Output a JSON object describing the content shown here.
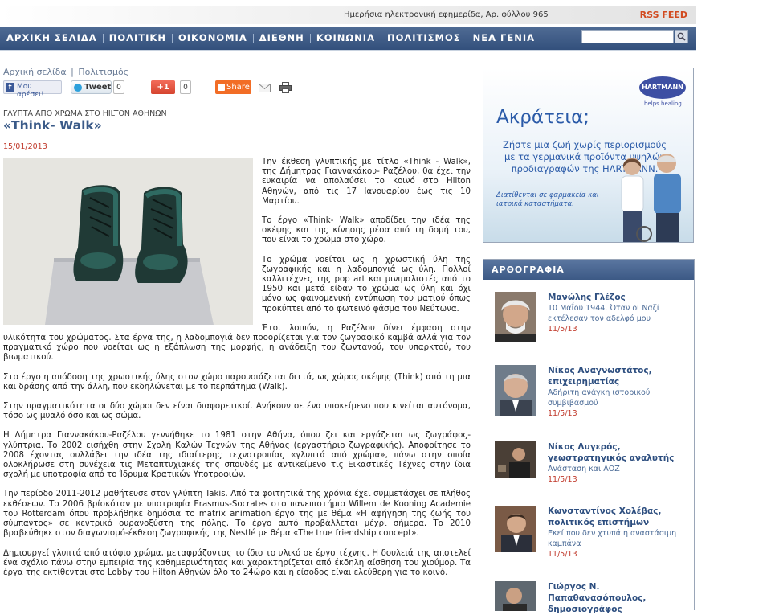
{
  "topbar": {
    "info": "Ημερήσια ηλεκτρονική εφημερίδα, Αρ. φύλλου 965",
    "rss": "RSS FEED"
  },
  "nav": {
    "items": [
      "ΑΡΧΙΚΗ ΣΕΛΙΔΑ",
      "ΠΟΛΙΤΙΚΗ",
      "ΟΙΚΟΝΟΜΙΑ",
      "ΔΙΕΘΝΗ",
      "ΚΟΙΝΩΝΙΑ",
      "ΠΟΛΙΤΙΣΜΟΣ",
      "ΝΕΑ ΓΕΝΙΑ"
    ],
    "search_placeholder": ""
  },
  "breadcrumb": {
    "home": "Αρχική σελίδα",
    "separator": "|",
    "section": "Πολιτισμός"
  },
  "social": {
    "facebook_label": "Μου αρέσει!",
    "facebook_icon": "f",
    "tweet_label": "Tweet",
    "tweet_count": "0",
    "gplus_label": "+1",
    "gplus_count": "0",
    "share_label": "Share"
  },
  "article": {
    "kicker": "ΓΛΥΠΤΑ ΑΠΟ ΧΡΩΜΑ ΣΤΟ HILTON ΑΘΗΝΩΝ",
    "title": "«Think- Walk»",
    "date": "15/01/2013",
    "paragraphs": [
      "Την έκθεση γλυπτικής με τίτλο «Think - Walk», της Δήμητρας Γιαννακάκου- Ραζέλου, θα έχει την ευκαιρία να απολαύσει το κοινό στο Hilton Αθηνών, από τις 17 Ιανουαρίου έως τις 10 Μαρτίου.",
      "Το έργο «Think- Walk» αποδίδει την ιδέα της σκέψης και της κίνησης μέσα από τη δομή του, που είναι το χρώμα στο χώρο.",
      "Το χρώμα νοείται ως η χρωστική ύλη της ζωγραφικής και η λαδομπογιά ως ύλη. Πολλοί καλλιτέχνες της pop art και μινιμαλιστές από το 1950 και μετά είδαν το χρώμα ως ύλη και όχι μόνο ως φαινομενική εντύπωση του ματιού όπως προκύπτει από το φωτεινό φάσμα του Νεύτωνα.",
      "Έτσι λοιπόν, η Ραζέλου δίνει έμφαση στην υλικότητα του χρώματος. Στα έργα της, η λαδομπογιά δεν προορίζεται για τον ζωγραφικό καμβά αλλά για τον πραγματικό χώρο που νοείται ως η εξάπλωση της μορφής, η ανάδειξη του ζωντανού, του υπαρκτού, του βιωματικού.",
      "Στο έργο η απόδοση της χρωστικής ύλης στον χώρο παρουσιάζεται διττά, ως χώρος σκέψης (Think) από τη μια και δράσης από την άλλη, που εκδηλώνεται με το περπάτημα (Walk).",
      "Στην πραγματικότητα οι δύο χώροι δεν είναι διαφορετικοί. Ανήκουν σε ένα υποκείμενο που κινείται αυτόνομα, τόσο ως μυαλό όσο και ως σώμα.",
      "Η Δήμητρα Γιαννακάκου-Ραζέλου γεννήθηκε το 1981 στην Αθήνα, όπου ζει και εργάζεται ως ζωγράφος-γλύπτρια. Το 2002 εισήχθη στην Σχολή Καλών Τεχνών της Αθήνας (εργαστήριο ζωγραφικής). Αποφοίτησε το 2008 έχοντας συλλάβει την ιδέα της ιδιαίτερης τεχνοτροπίας «γλυπτά από χρώμα», πάνω στην οποία ολοκλήρωσε στη συνέχεια τις Μεταπτυχιακές της σπουδές με αντικείμενο τις Εικαστικές Τέχνες στην ίδια σχολή με υποτροφία από το Ίδρυμα Κρατικών Υποτροφιών.",
      "Την περίοδο 2011-2012 μαθήτευσε στον γλύπτη Takis.  Από τα φοιτητικά της χρόνια έχει συμμετάσχει σε πλήθος εκθέσεων. Το 2006 βρίσκόταν με  υποτροφία Erasmus-Socrates στο πανεπιστήμιο  Willem de Kooning Academie του Rotterdam όπου προβλήθηκε δημόσια το matrix animation έργο της με θέμα «Η αφήγηση της ζωής του σύμπαντος» σε κεντρικό ουρανοξύστη της πόλης. Το έργο αυτό προβάλλεται μέχρι σήμερα. Το 2010 βραβεύθηκε στον διαγωνισμό-έκθεση ζωγραφικής της Nestlé με θέμα «The true friendship concept».",
      "Δημιουργεί γλυπτά από ατόφιο χρώμα, μεταφράζοντας το ίδιο το υλικό σε έργο τέχνης. Η δουλειά της αποτελεί ένα σχόλιο πάνω στην εμπειρία της καθημερινότητας και χαρακτηρίζεται από έκδηλη αίσθηση του χιούμορ. Τα έργα της εκτίθενται στο Lobby του Hilton Αθηνών όλο το 24ώρο και η είσοδος είναι ελεύθερη για το κοινό."
    ]
  },
  "ad": {
    "brand": "HARTMANN",
    "tagline": "helps healing.",
    "headline": "Ακράτεια;",
    "pitch": "Ζήστε μια ζωή χωρίς περιορισμούς με τα γερμανικά προϊόντα υψηλών προδιαγραφών της HARTMANN.",
    "small": "Διατίθενται σε φαρμακεία και ιατρικά καταστήματα."
  },
  "columns": {
    "header": "ΑΡΘΟΓΡΑΦΙΑ",
    "entries": [
      {
        "name": "Μανώλης Γλέζος",
        "summary": "10 Μαΐου 1944. Όταν οι Ναζί εκτέλεσαν τον αδελφό μου",
        "date": "11/5/13"
      },
      {
        "name": "Νίκος Αναγνωστάτος, επιχειρηματίας",
        "summary": "Αδήριτη ανάγκη ιστορικού συμβιβασμού",
        "date": "11/5/13"
      },
      {
        "name": "Νίκος Λυγερός, γεωστρατηγικός αναλυτής",
        "summary": "Ανάσταση και ΑΟΖ",
        "date": "11/5/13"
      },
      {
        "name": "Κωνσταντίνος Χολέβας, πολιτικός επιστήμων",
        "summary": "Εκεί που δεν χτυπά η αναστάσιμη καμπάνα",
        "date": "11/5/13"
      },
      {
        "name": "Γιώργος Ν. Παπαθανασόπουλος, δημοσιογράφος",
        "summary": "",
        "date": ""
      }
    ]
  },
  "colors": {
    "nav_top": "#4f6b94",
    "nav_bottom": "#33507c",
    "link": "#3a5a88",
    "date_red": "#c0392b",
    "rss_orange": "#d24a1f"
  }
}
